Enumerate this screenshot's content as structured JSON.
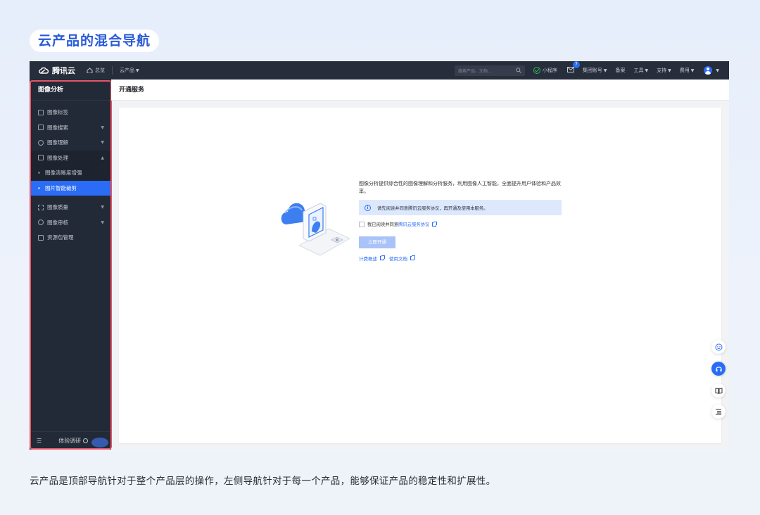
{
  "page": {
    "heading": "云产品的混合导航",
    "caption": "云产品是顶部导航针对于整个产品层的操作，左侧导航针对于每一个产品，能够保证产品的稳定性和扩展性。"
  },
  "topbar": {
    "brand": "腾讯云",
    "home": "总览",
    "products": "云产品",
    "search_placeholder": "搜索产品、文档...",
    "miniprogram": "小程序",
    "mail_badge": "7",
    "account": "集团账号",
    "filing": "备案",
    "tools": "工具",
    "support": "支持",
    "billing": "费用"
  },
  "sidebar": {
    "title": "图像分析",
    "items": [
      {
        "label": "图像标签"
      },
      {
        "label": "图像搜索"
      },
      {
        "label": "图像理解"
      },
      {
        "label": "图像处理"
      },
      {
        "label": "图像清晰度增强"
      },
      {
        "label": "图片智能裁剪"
      },
      {
        "label": "图像质量"
      },
      {
        "label": "图像审核"
      },
      {
        "label": "资源包管理"
      }
    ],
    "survey": "体验调研"
  },
  "content": {
    "header": "开通服务",
    "intro": "图像分析提供综合性的图像理解和分析服务，利用图像人工智能，全面提升用户体验和产品效率。",
    "notice": "请先阅读并同意腾讯云服务协议，再开通及使用本服务。",
    "agree_prefix": "我已阅读并同意",
    "agree_link": "腾讯云服务协议",
    "open_button": "立即开通",
    "link_pricing": "计费概述",
    "link_docs": "使用文档"
  },
  "colors": {
    "accent": "#2a6cf6",
    "topbar_bg": "#262d3b",
    "sidebar_bg": "#232a37",
    "highlight_outline": "#e85566"
  }
}
